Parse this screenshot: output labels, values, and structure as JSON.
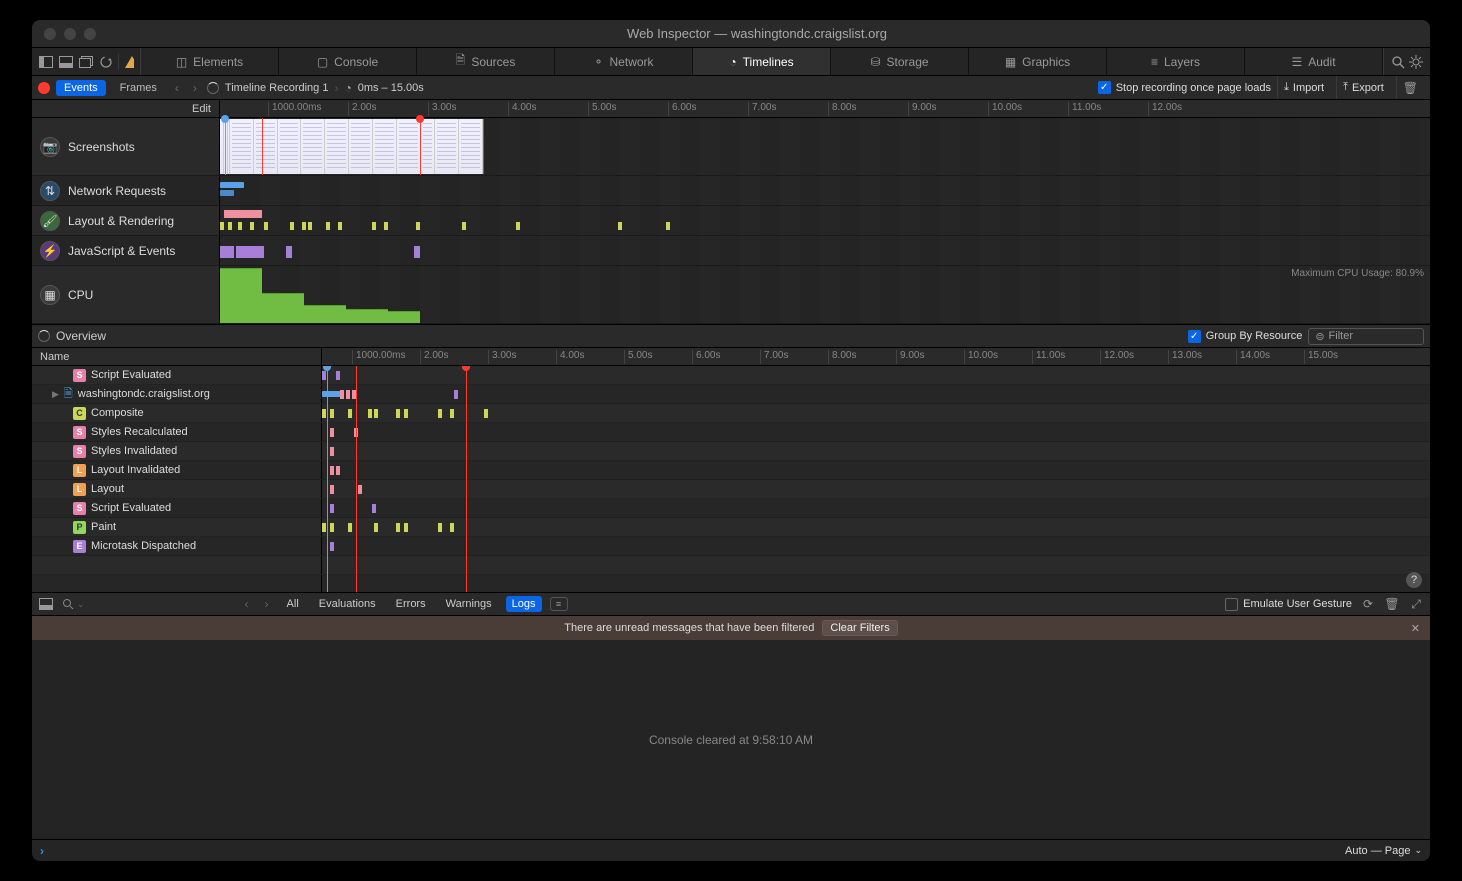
{
  "window": {
    "title": "Web Inspector — washingtondc.craigslist.org"
  },
  "tabs": [
    {
      "label": "Elements"
    },
    {
      "label": "Console"
    },
    {
      "label": "Sources"
    },
    {
      "label": "Network"
    },
    {
      "label": "Timelines",
      "active": true
    },
    {
      "label": "Storage"
    },
    {
      "label": "Graphics"
    },
    {
      "label": "Layers"
    },
    {
      "label": "Audit"
    }
  ],
  "subbar": {
    "view_events": "Events",
    "view_frames": "Frames",
    "recording_name": "Timeline Recording 1",
    "time_range": "0ms – 15.00s",
    "stop_recording_label": "Stop recording once page loads",
    "import_label": "Import",
    "export_label": "Export"
  },
  "ruler": {
    "edit": "Edit",
    "ticks_top": [
      "1000.00ms",
      "2.00s",
      "3.00s",
      "4.00s",
      "5.00s",
      "6.00s",
      "7.00s",
      "8.00s",
      "9.00s",
      "10.00s",
      "11.00s",
      "12.00s"
    ],
    "ticks_detail": [
      "1000.00ms",
      "2.00s",
      "3.00s",
      "4.00s",
      "5.00s",
      "6.00s",
      "7.00s",
      "8.00s",
      "9.00s",
      "10.00s",
      "11.00s",
      "12.00s",
      "13.00s",
      "14.00s",
      "15.00s"
    ]
  },
  "timeline_labels": {
    "screenshots": "Screenshots",
    "network": "Network Requests",
    "layout": "Layout & Rendering",
    "js": "JavaScript & Events",
    "cpu": "CPU"
  },
  "cpu_max": "Maximum CPU Usage: 80.9%",
  "overview": {
    "label": "Overview",
    "group_label": "Group By Resource",
    "filter_placeholder": "Filter"
  },
  "detail_header": "Name",
  "detail_rows": [
    {
      "badge": "S",
      "label": "Script Evaluated"
    },
    {
      "doc": true,
      "label": "washingtondc.craigslist.org",
      "expandable": true
    },
    {
      "badge": "C",
      "label": "Composite"
    },
    {
      "badge": "S",
      "label": "Styles Recalculated"
    },
    {
      "badge": "S",
      "label": "Styles Invalidated"
    },
    {
      "badge": "L",
      "label": "Layout Invalidated"
    },
    {
      "badge": "L",
      "label": "Layout"
    },
    {
      "badge": "S",
      "label": "Script Evaluated"
    },
    {
      "badge": "P",
      "label": "Paint"
    },
    {
      "badge": "E",
      "label": "Microtask Dispatched"
    }
  ],
  "console": {
    "filters": {
      "all": "All",
      "evaluations": "Evaluations",
      "errors": "Errors",
      "warnings": "Warnings",
      "logs": "Logs"
    },
    "emulate_label": "Emulate User Gesture",
    "unread_msg": "There are unread messages that have been filtered",
    "clear_filters": "Clear Filters",
    "cleared_msg": "Console cleared at 9:58:10 AM",
    "page_selector": "Auto — Page"
  },
  "colors": {
    "accent": "#0a66e6",
    "record": "#ff3b30"
  }
}
